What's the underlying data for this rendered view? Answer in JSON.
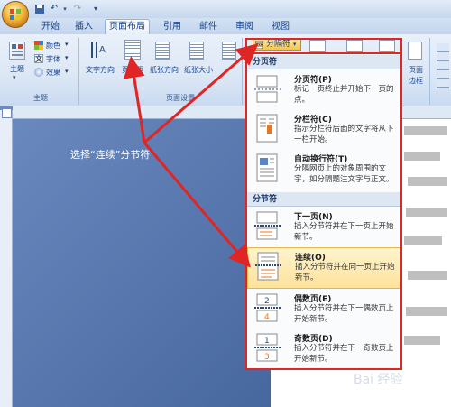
{
  "tabs": [
    "开始",
    "插入",
    "页面布局",
    "引用",
    "邮件",
    "审阅",
    "视图"
  ],
  "ribbon": {
    "theme_group": {
      "theme": "主题",
      "colors": "颜色",
      "fonts": "字体",
      "effects": "效果",
      "label": "主题"
    },
    "page_setup": {
      "text_direction": "文字方向",
      "margins": "页边距",
      "orientation": "纸张方向",
      "size": "纸张大小",
      "label": "页面设置"
    },
    "breaks_button": "分隔符",
    "page_border": [
      "页面",
      "边框"
    ]
  },
  "annotation": "选择“连续”分节符",
  "menu": {
    "section_page": "分页符",
    "section_section": "分节符",
    "items": [
      {
        "title": "分页符(P)",
        "desc": "标记一页终止并开始下一页的点。"
      },
      {
        "title": "分栏符(C)",
        "desc": "指示分栏符后面的文字将从下一栏开始。"
      },
      {
        "title": "自动换行符(T)",
        "desc": "分隔网页上的对象周围的文字，如分隔题注文字与正文。"
      },
      {
        "title": "下一页(N)",
        "desc": "插入分节符并在下一页上开始新节。"
      },
      {
        "title": "连续(O)",
        "desc": "插入分节符并在同一页上开始新节。"
      },
      {
        "title": "偶数页(E)",
        "desc": "插入分节符并在下一偶数页上开始新节。"
      },
      {
        "title": "奇数页(D)",
        "desc": "插入分节符并在下一奇数页上开始新节。"
      }
    ]
  },
  "watermark": "Bai 经验",
  "colors": {
    "highlight_red": "#e02525",
    "ribbon_bg": "#dce7f5",
    "selected_item": "#fde29a"
  }
}
